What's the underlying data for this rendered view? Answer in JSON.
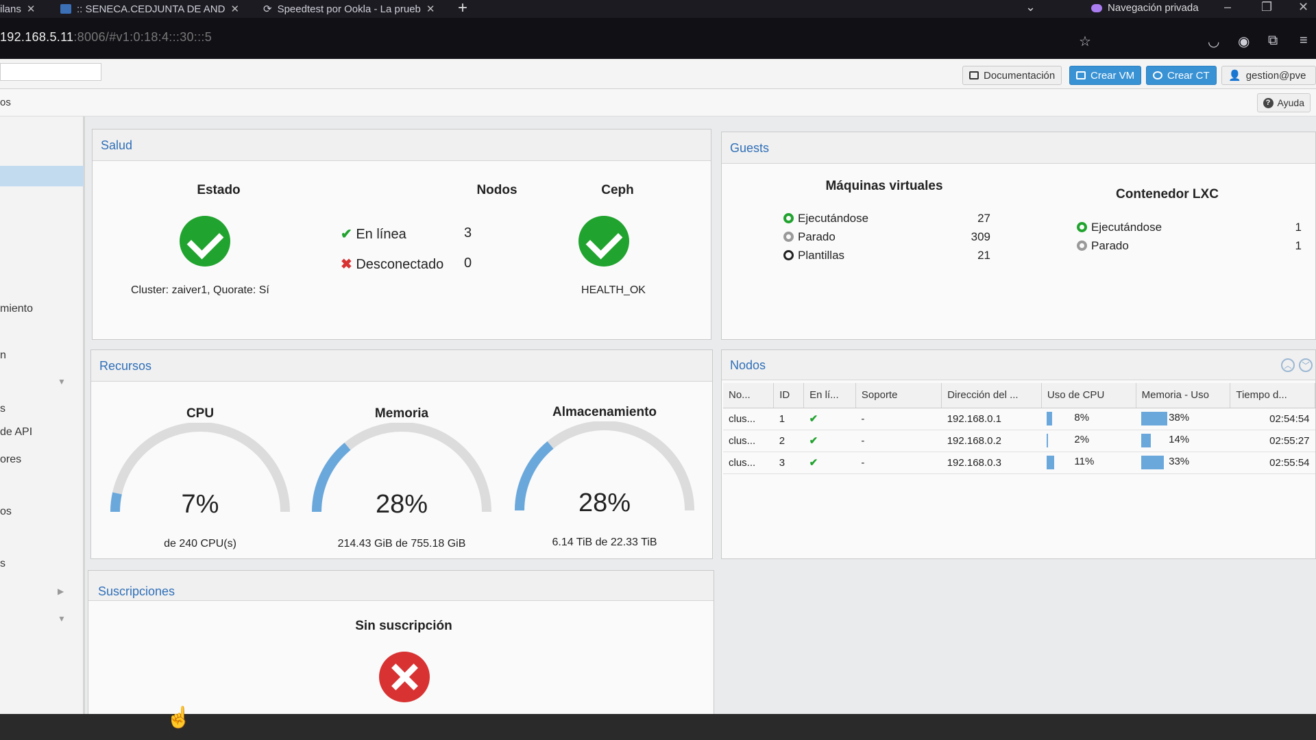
{
  "browser": {
    "tabs": [
      {
        "label": "ilans"
      },
      {
        "label": ":: SENECA.CEDJUNTA DE AND"
      },
      {
        "label": "Speedtest por Ookla - La prueb"
      }
    ],
    "private_label": "Navegación privada",
    "url_main": "192.168.5.11",
    "url_rest": ":8006/#v1:0:18:4:::30:::5"
  },
  "header": {
    "docs_label": "Documentación",
    "create_vm_label": "Crear VM",
    "create_ct_label": "Crear CT",
    "user_label": "gestion@pve",
    "help_label": "Ayuda",
    "crumb": "os"
  },
  "sidebar": {
    "items": [
      "miento",
      "n",
      "s",
      "de API",
      "ores",
      "os",
      "s"
    ]
  },
  "salud": {
    "title": "Salud",
    "estado_title": "Estado",
    "estado_text": "Cluster: zaiver1, Quorate: Sí",
    "nodos_title": "Nodos",
    "online_label": "En línea",
    "online_count": "3",
    "offline_label": "Desconectado",
    "offline_count": "0",
    "ceph_title": "Ceph",
    "ceph_status": "HEALTH_OK"
  },
  "guests": {
    "title": "Guests",
    "vm_title": "Máquinas virtuales",
    "vm_rows": [
      {
        "label": "Ejecutándose",
        "value": "27"
      },
      {
        "label": "Parado",
        "value": "309"
      },
      {
        "label": "Plantillas",
        "value": "21"
      }
    ],
    "lxc_title": "Contenedor LXC",
    "lxc_rows": [
      {
        "label": "Ejecutándose",
        "value": "1"
      },
      {
        "label": "Parado",
        "value": "1"
      }
    ]
  },
  "recursos": {
    "title": "Recursos",
    "gauges": [
      {
        "title": "CPU",
        "value_text": "7%",
        "fraction": 0.07,
        "sub": "de 240 CPU(s)"
      },
      {
        "title": "Memoria",
        "value_text": "28%",
        "fraction": 0.28,
        "sub": "214.43 GiB de 755.18 GiB"
      },
      {
        "title": "Almacenamiento",
        "value_text": "28%",
        "fraction": 0.28,
        "sub": "6.14 TiB de 22.33 TiB"
      }
    ]
  },
  "nodos_panel": {
    "title": "Nodos",
    "columns": [
      "No...",
      "ID",
      "En lí...",
      "Soporte",
      "Dirección del ...",
      "Uso de CPU",
      "Memoria - Uso",
      "Tiempo d..."
    ],
    "rows": [
      {
        "name": "clus...",
        "id": "1",
        "support": "-",
        "ip": "192.168.0.1",
        "cpu": "8%",
        "cpu_frac": 0.08,
        "mem": "38%",
        "mem_frac": 0.38,
        "uptime": "02:54:54"
      },
      {
        "name": "clus...",
        "id": "2",
        "support": "-",
        "ip": "192.168.0.2",
        "cpu": "2%",
        "cpu_frac": 0.02,
        "mem": "14%",
        "mem_frac": 0.14,
        "uptime": "02:55:27"
      },
      {
        "name": "clus...",
        "id": "3",
        "support": "-",
        "ip": "192.168.0.3",
        "cpu": "11%",
        "cpu_frac": 0.11,
        "mem": "33%",
        "mem_frac": 0.33,
        "uptime": "02:55:54"
      }
    ]
  },
  "suscripciones": {
    "title": "Suscripciones",
    "status": "Sin suscripción"
  },
  "colors": {
    "ok_green": "#21a32f",
    "error_red": "#d83232",
    "accent_blue": "#3892d4",
    "gauge_blue": "#6aa8dc"
  }
}
